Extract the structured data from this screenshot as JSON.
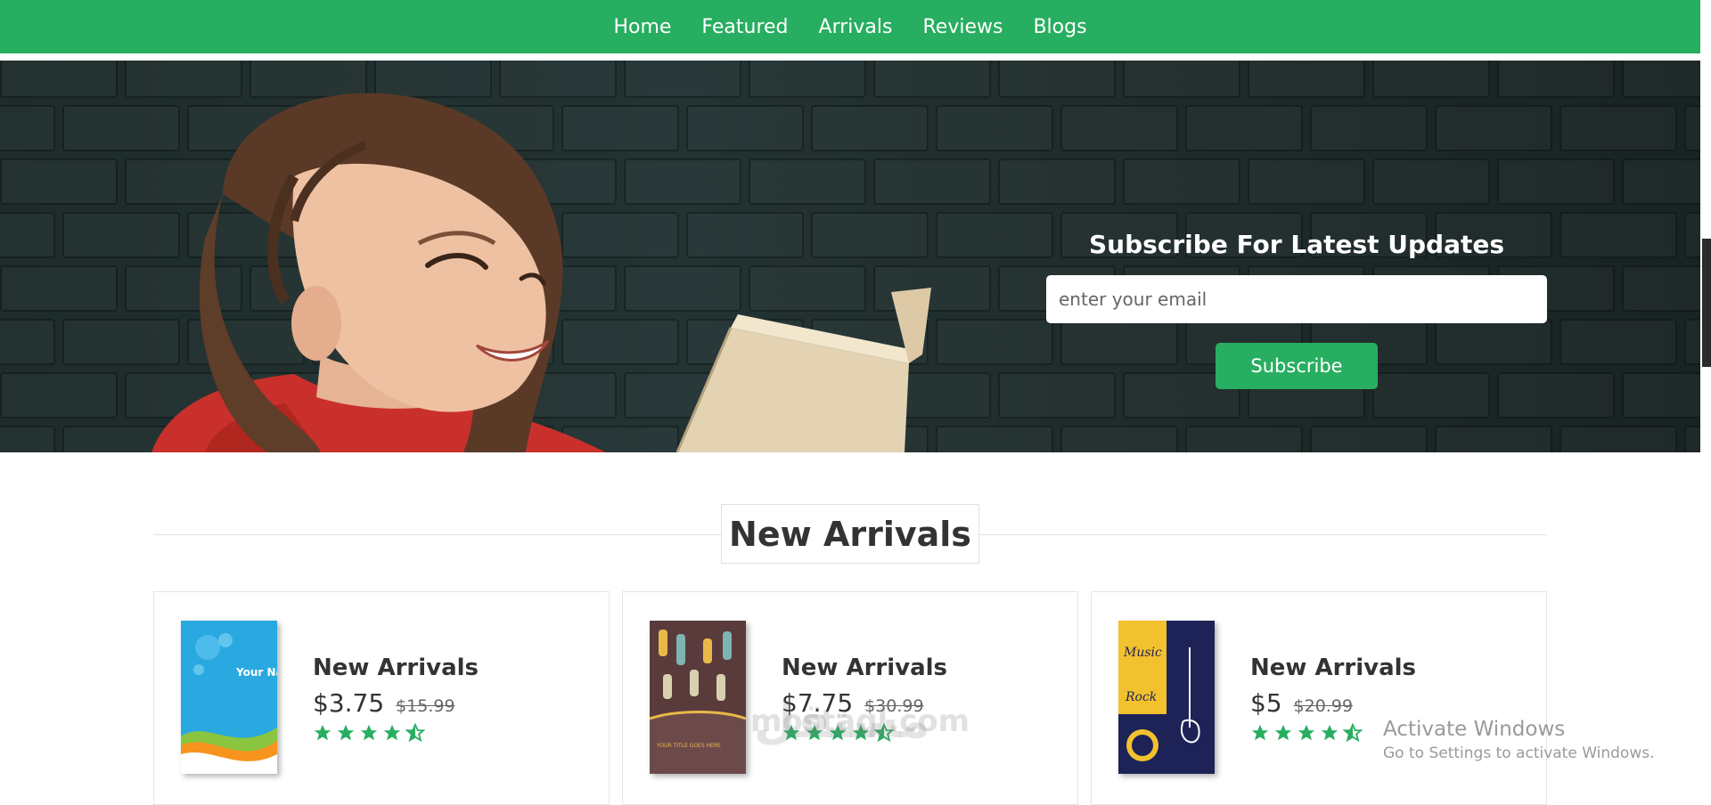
{
  "nav": {
    "items": [
      {
        "label": "Home"
      },
      {
        "label": "Featured"
      },
      {
        "label": "Arrivals"
      },
      {
        "label": "Reviews"
      },
      {
        "label": "Blogs"
      }
    ]
  },
  "subscribe": {
    "title": "Subscribe For Latest Updates",
    "email_placeholder": "enter your email",
    "button_label": "Subscribe"
  },
  "section": {
    "heading": "New Arrivals"
  },
  "products": [
    {
      "title": "New Arrivals",
      "price": "$3.75",
      "old_price": "$15.99",
      "rating": 4.5,
      "cover_text": "Your Name"
    },
    {
      "title": "New Arrivals",
      "price": "$7.75",
      "old_price": "$30.99",
      "rating": 4.5,
      "cover_text": "YOUR TITLE GOES HERE"
    },
    {
      "title": "New Arrivals",
      "price": "$5",
      "old_price": "$20.99",
      "rating": 4.5,
      "cover_text_1": "Music",
      "cover_text_2": "Rock"
    }
  ],
  "colors": {
    "brand": "#27ae60",
    "hero_dark": "#1d2b2b"
  },
  "os_watermark": {
    "title": "Activate Windows",
    "subtitle": "Go to Settings to activate Windows."
  },
  "site_watermark": {
    "latin": "mostaql.com",
    "arabic": "مستقل"
  }
}
